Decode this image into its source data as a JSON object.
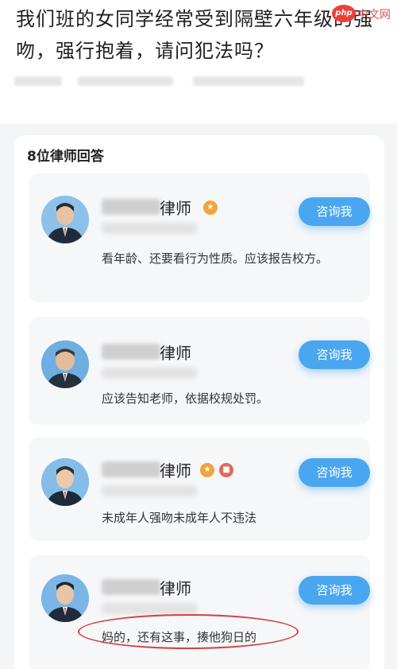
{
  "question": {
    "title": "我们班的女同学经常受到隔壁六年级的强吻，强行抱着，请问犯法吗？"
  },
  "watermark": {
    "logo_text": "php",
    "site_text": "中文网"
  },
  "answers": {
    "count_label": "8位律师回答",
    "items": [
      {
        "lawyer_suffix": "律师",
        "badges": [
          "orange"
        ],
        "consult_label": "咨询我",
        "text": "看年龄、还要看行为性质。应该报告校方。"
      },
      {
        "lawyer_suffix": "律师",
        "badges": [],
        "consult_label": "咨询我",
        "text": "应该告知老师，依据校规处罚。"
      },
      {
        "lawyer_suffix": "律师",
        "badges": [
          "orange",
          "red"
        ],
        "consult_label": "咨询我",
        "text": "未成年人强吻未成年人不违法"
      },
      {
        "lawyer_suffix": "律师",
        "badges": [],
        "consult_label": "咨询我",
        "text": "妈的，还有这事，揍他狗日的"
      }
    ]
  },
  "colors": {
    "accent": "#4aa6ef",
    "highlight": "#d0423f",
    "page_bg": "#f4f5f7",
    "card_bg": "#f6f7f9"
  }
}
